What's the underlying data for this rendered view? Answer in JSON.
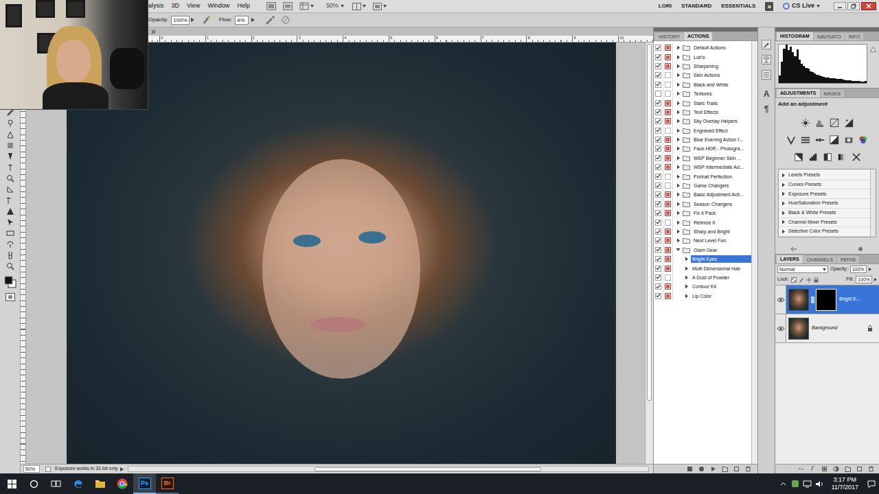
{
  "menu_bar": {
    "items": [
      "alysis",
      "3D",
      "View",
      "Window",
      "Help"
    ],
    "zoom": "50%",
    "workspaces": [
      "LORI",
      "STANDARD",
      "ESSENTIALS"
    ],
    "more": "»",
    "cs_live": "CS Live"
  },
  "options_bar": {
    "opacity_label": "Opacity:",
    "opacity": "100%",
    "flow_label": "Flow:",
    "flow": "4%"
  },
  "document": {
    "ruler_top": [
      "0",
      "1",
      "2",
      "3",
      "4",
      "5",
      "6",
      "7",
      "8",
      "9",
      "10"
    ]
  },
  "status_bar": {
    "zoom": "50%",
    "message": "Exposure works in 32-bit only"
  },
  "actions_panel": {
    "tabs": [
      {
        "label": "HISTORY",
        "selected": false
      },
      {
        "label": "ACTIONS",
        "selected": true
      }
    ],
    "items": [
      {
        "label": "Default Actions",
        "kind": "set",
        "checked": true,
        "dialog": true,
        "expanded": false,
        "selected": false
      },
      {
        "label": "Lori's",
        "kind": "set",
        "checked": true,
        "dialog": true,
        "expanded": false,
        "selected": false
      },
      {
        "label": "Sharpening",
        "kind": "set",
        "checked": true,
        "dialog": true,
        "expanded": false,
        "selected": false
      },
      {
        "label": "Skin Actions",
        "kind": "set",
        "checked": true,
        "dialog": false,
        "expanded": false,
        "selected": false
      },
      {
        "label": "Black and White",
        "kind": "set",
        "checked": true,
        "dialog": false,
        "expanded": false,
        "selected": false
      },
      {
        "label": "Textures",
        "kind": "set",
        "checked": false,
        "dialog": false,
        "expanded": false,
        "selected": false
      },
      {
        "label": "Stars Trails",
        "kind": "set",
        "checked": true,
        "dialog": true,
        "expanded": false,
        "selected": false
      },
      {
        "label": "Text Effects",
        "kind": "set",
        "checked": true,
        "dialog": true,
        "expanded": false,
        "selected": false
      },
      {
        "label": "Sky Overlay Helpers",
        "kind": "set",
        "checked": true,
        "dialog": true,
        "expanded": false,
        "selected": false
      },
      {
        "label": "Engraved Effect",
        "kind": "set",
        "checked": true,
        "dialog": false,
        "expanded": false,
        "selected": false
      },
      {
        "label": "Blue Evening Action f...",
        "kind": "set",
        "checked": true,
        "dialog": true,
        "expanded": false,
        "selected": false
      },
      {
        "label": "Faux HDR - Photogra...",
        "kind": "set",
        "checked": true,
        "dialog": true,
        "expanded": false,
        "selected": false
      },
      {
        "label": "WSP Beginner Skin ...",
        "kind": "set",
        "checked": true,
        "dialog": true,
        "expanded": false,
        "selected": false
      },
      {
        "label": "WSP Intermediate Ad...",
        "kind": "set",
        "checked": true,
        "dialog": true,
        "expanded": false,
        "selected": false
      },
      {
        "label": "Portrait Perfection",
        "kind": "set",
        "checked": true,
        "dialog": false,
        "expanded": false,
        "selected": false
      },
      {
        "label": "Game Changers",
        "kind": "set",
        "checked": true,
        "dialog": false,
        "expanded": false,
        "selected": false
      },
      {
        "label": "Basic Adjustment Acti...",
        "kind": "set",
        "checked": true,
        "dialog": true,
        "expanded": false,
        "selected": false
      },
      {
        "label": "Season Changers",
        "kind": "set",
        "checked": true,
        "dialog": true,
        "expanded": false,
        "selected": false
      },
      {
        "label": "Fix it Pack",
        "kind": "set",
        "checked": true,
        "dialog": true,
        "expanded": false,
        "selected": false
      },
      {
        "label": "Retinize It",
        "kind": "set",
        "checked": true,
        "dialog": false,
        "expanded": false,
        "selected": false
      },
      {
        "label": "Sharp and Bright",
        "kind": "set",
        "checked": true,
        "dialog": true,
        "expanded": false,
        "selected": false
      },
      {
        "label": "Next Level Fun",
        "kind": "set",
        "checked": true,
        "dialog": true,
        "expanded": false,
        "selected": false
      },
      {
        "label": "Glam Gear",
        "kind": "set",
        "checked": true,
        "dialog": true,
        "expanded": true,
        "selected": false
      },
      {
        "label": "Bright Eyes",
        "kind": "action",
        "checked": true,
        "dialog": true,
        "expanded": false,
        "selected": true
      },
      {
        "label": "Multi Dimensional Hair",
        "kind": "action",
        "checked": true,
        "dialog": true,
        "expanded": false,
        "selected": false
      },
      {
        "label": "A Dust of Powder",
        "kind": "action",
        "checked": true,
        "dialog": false,
        "expanded": false,
        "selected": false
      },
      {
        "label": "Contour Kit",
        "kind": "action",
        "checked": true,
        "dialog": true,
        "expanded": false,
        "selected": false
      },
      {
        "label": "Lip Color",
        "kind": "action",
        "checked": true,
        "dialog": true,
        "expanded": false,
        "selected": false
      }
    ]
  },
  "panel_dock": {
    "character": "A",
    "paragraph": "¶"
  },
  "histogram_panel": {
    "tabs": [
      {
        "label": "HISTOGRAM",
        "selected": true
      },
      {
        "label": "NAVIGATO",
        "selected": false
      },
      {
        "label": "INFO",
        "selected": false
      }
    ],
    "values": [
      20,
      55,
      90,
      100,
      85,
      95,
      80,
      70,
      88,
      60,
      50,
      45,
      40,
      38,
      30,
      28,
      25,
      22,
      20,
      18,
      16,
      15,
      14,
      13,
      12,
      12,
      11,
      10,
      10,
      9,
      8,
      8,
      7,
      6,
      6,
      5,
      5,
      4,
      3,
      6
    ]
  },
  "adjustments_panel": {
    "tabs": [
      {
        "label": "ADJUSTMENTS",
        "selected": true
      },
      {
        "label": "MASKS",
        "selected": false
      }
    ],
    "heading": "Add an adjustment",
    "presets": [
      "Levels Presets",
      "Curves Presets",
      "Exposure Presets",
      "Hue/Saturation Presets",
      "Black & White Presets",
      "Channel Mixer Presets",
      "Selective Color Presets"
    ]
  },
  "layers_panel": {
    "tabs": [
      {
        "label": "LAYERS",
        "selected": true
      },
      {
        "label": "CHANNELS",
        "selected": false
      },
      {
        "label": "PATHS",
        "selected": false
      }
    ],
    "blend_mode": "Normal",
    "opacity_label": "Opacity:",
    "opacity": "100%",
    "lock_label": "Lock:",
    "fill_label": "Fill:",
    "fill": "100%",
    "layers": [
      {
        "name": "Bright E...",
        "selected": true,
        "visible": true,
        "has_mask": true,
        "locked": false
      },
      {
        "name": "Background",
        "selected": false,
        "visible": true,
        "has_mask": false,
        "locked": true
      }
    ]
  },
  "taskbar": {
    "apps": [
      {
        "label": "Ps",
        "selected": true
      },
      {
        "label": "Br",
        "selected": false
      }
    ],
    "time": "3:17 PM",
    "date": "11/7/2017"
  }
}
